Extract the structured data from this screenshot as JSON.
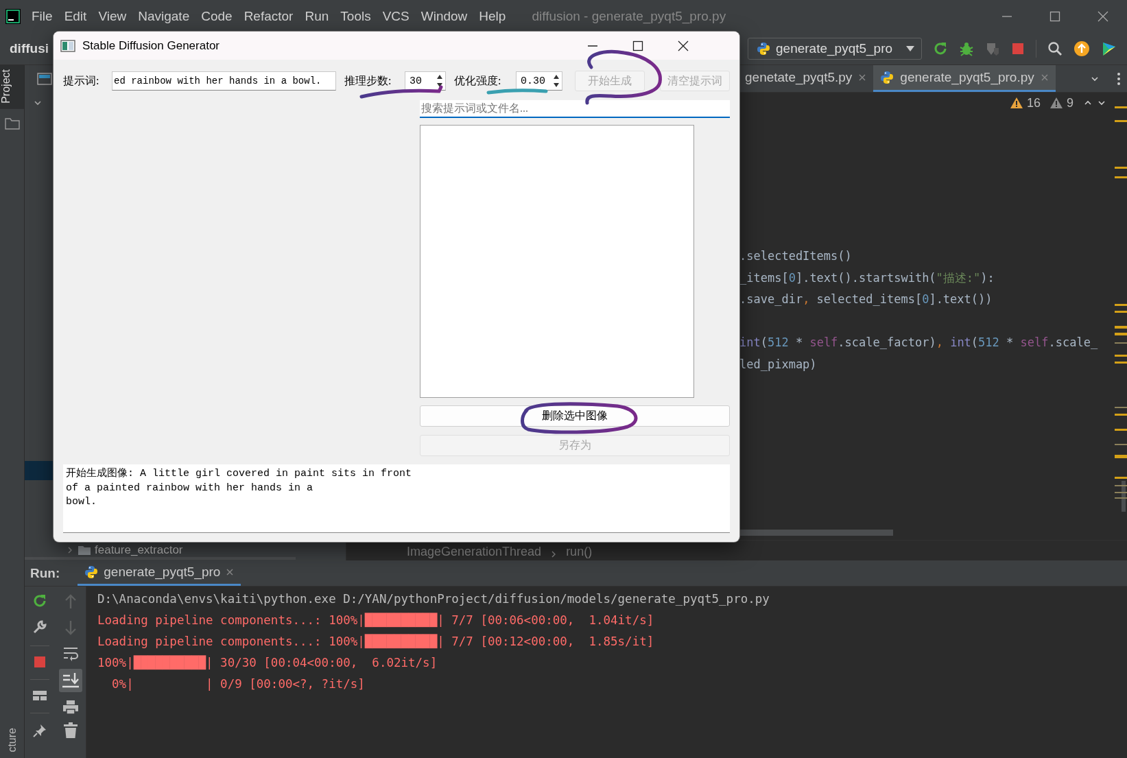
{
  "ide": {
    "menu": [
      "File",
      "Edit",
      "View",
      "Navigate",
      "Code",
      "Refactor",
      "Run",
      "Tools",
      "VCS",
      "Window",
      "Help"
    ],
    "window_title": "diffusion - generate_pyqt5_pro.py",
    "project_name": "diffusi",
    "run_config": "generate_pyqt5_pro",
    "side_tabs": {
      "top": "Project",
      "bottom": "cture"
    },
    "project_tree": {
      "visible_item": "feature_extractor"
    },
    "editor_tabs": [
      {
        "label": "genetate_pyqt5.py",
        "selected": false
      },
      {
        "label": "generate_pyqt5_pro.py",
        "selected": true
      }
    ],
    "inspections": {
      "warnings": "16",
      "weak_warnings": "9"
    },
    "code_blocks": [
      [
        [
          {
            "kind": "plain",
            "t": ".selectedItems()"
          }
        ],
        [
          {
            "kind": "plain",
            "t": "_items["
          },
          {
            "kind": "num",
            "t": "0"
          },
          {
            "kind": "plain",
            "t": "].text().startswith("
          },
          {
            "kind": "str",
            "t": "\"描述:\""
          },
          {
            "kind": "plain",
            "t": "):"
          }
        ],
        [
          {
            "kind": "plain",
            "t": ".save_dir"
          },
          {
            "kind": "punct",
            "t": ","
          },
          {
            "kind": "plain",
            "t": " selected_items["
          },
          {
            "kind": "num",
            "t": "0"
          },
          {
            "kind": "plain",
            "t": "].text())"
          }
        ]
      ],
      [
        [
          {
            "kind": "builtin",
            "t": "int"
          },
          {
            "kind": "plain",
            "t": "("
          },
          {
            "kind": "num",
            "t": "512"
          },
          {
            "kind": "plain",
            "t": " * "
          },
          {
            "kind": "self",
            "t": "self"
          },
          {
            "kind": "plain",
            "t": ".scale_factor)"
          },
          {
            "kind": "punct",
            "t": ", "
          },
          {
            "kind": "builtin",
            "t": "int"
          },
          {
            "kind": "plain",
            "t": "("
          },
          {
            "kind": "num",
            "t": "512"
          },
          {
            "kind": "plain",
            "t": " * "
          },
          {
            "kind": "self",
            "t": "self"
          },
          {
            "kind": "plain",
            "t": ".scale_"
          }
        ],
        [
          {
            "kind": "plain",
            "t": "led_pixmap)"
          }
        ]
      ]
    ],
    "breadcrumb": [
      "ImageGenerationThread",
      "run()"
    ],
    "run_panel": {
      "label": "Run:",
      "tab": "generate_pyqt5_pro",
      "console": [
        {
          "kind": "command",
          "text": "D:\\Anaconda\\envs\\kaiti\\python.exe D:/YAN/pythonProject/diffusion/models/generate_pyqt5_pro.py"
        },
        {
          "kind": "stderr",
          "text": "Loading pipeline components...: 100%|██████████| 7/7 [00:06<00:00,  1.04it/s]"
        },
        {
          "kind": "stderr",
          "text": "Loading pipeline components...: 100%|██████████| 7/7 [00:12<00:00,  1.85s/it]"
        },
        {
          "kind": "stderr",
          "text": "100%|██████████| 30/30 [00:04<00:00,  6.02it/s]"
        },
        {
          "kind": "stderr",
          "text": "  0%|          | 0/9 [00:00<?, ?it/s]"
        }
      ]
    }
  },
  "dialog": {
    "title": "Stable Diffusion Generator",
    "prompt": {
      "label": "提示词:",
      "value": "ed rainbow with her hands in a bowl."
    },
    "steps": {
      "label": "推理步数:",
      "value": "30"
    },
    "strength": {
      "label": "优化强度:",
      "value": "0.30"
    },
    "top_buttons": [
      {
        "label": "开始生成",
        "disabled": true
      },
      {
        "label": "清空提示词",
        "disabled": true
      }
    ],
    "search": {
      "placeholder": "搜索提示词或文件名..."
    },
    "side_buttons": [
      {
        "label": "删除选中图像",
        "disabled": false
      },
      {
        "label": "另存为",
        "disabled": true
      }
    ],
    "log": "开始生成图像: A little girl covered in paint sits in front\nof a painted rainbow with her hands in a\nbowl."
  }
}
